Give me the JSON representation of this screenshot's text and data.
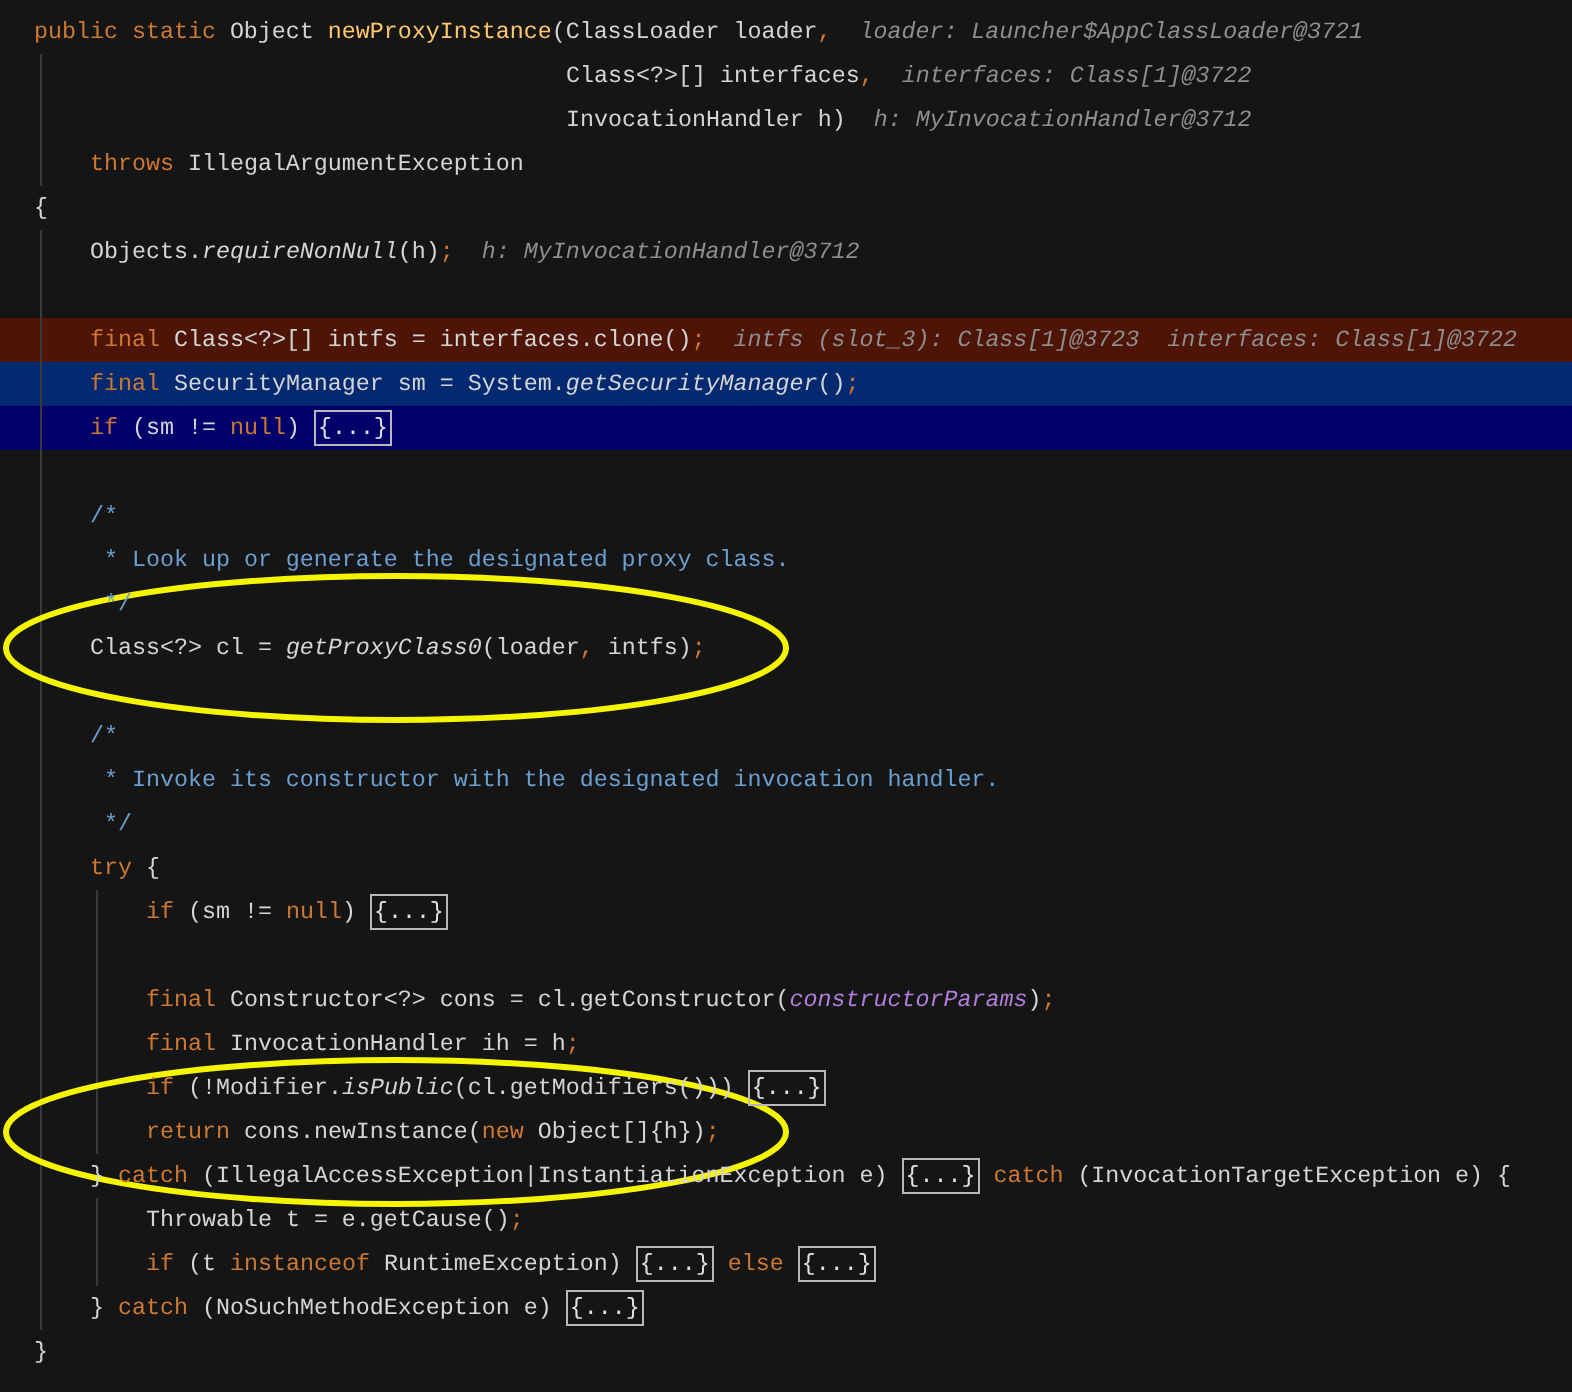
{
  "lines": [
    {
      "kind": "plain",
      "circled": false,
      "tokens": [
        {
          "kind": "kw",
          "text": "public static "
        },
        {
          "kind": "plain",
          "text": "Object "
        },
        {
          "kind": "method",
          "text": "newProxyInstance"
        },
        {
          "kind": "plain",
          "text": "(ClassLoader loader"
        },
        {
          "kind": "punct",
          "text": ","
        },
        {
          "kind": "hint",
          "text": "loader: Launcher$AppClassLoader@3721"
        }
      ]
    },
    {
      "kind": "plain",
      "circled": false,
      "tokens": [
        {
          "kind": "plain",
          "text": "                                      Class<?>[] interfaces"
        },
        {
          "kind": "punct",
          "text": ","
        },
        {
          "kind": "hint",
          "text": "interfaces: Class[1]@3722"
        }
      ]
    },
    {
      "kind": "plain",
      "circled": false,
      "tokens": [
        {
          "kind": "plain",
          "text": "                                      InvocationHandler h)"
        },
        {
          "kind": "hint",
          "text": "h: MyInvocationHandler@3712"
        }
      ]
    },
    {
      "kind": "plain",
      "circled": false,
      "tokens": [
        {
          "kind": "kw",
          "text": "    throws "
        },
        {
          "kind": "plain",
          "text": "IllegalArgumentException"
        }
      ]
    },
    {
      "kind": "plain",
      "circled": false,
      "tokens": [
        {
          "kind": "plain",
          "text": "{"
        }
      ]
    },
    {
      "kind": "plain",
      "circled": false,
      "tokens": [
        {
          "kind": "plain",
          "text": "    Objects."
        },
        {
          "kind": "static",
          "text": "requireNonNull"
        },
        {
          "kind": "plain",
          "text": "(h)"
        },
        {
          "kind": "punct",
          "text": ";"
        },
        {
          "kind": "hint",
          "text": "h: MyInvocationHandler@3712"
        }
      ]
    },
    {
      "kind": "plain",
      "circled": false
    },
    {
      "kind": "breakpoint",
      "circled": false,
      "tokens": [
        {
          "kind": "kw",
          "text": "    final "
        },
        {
          "kind": "plain",
          "text": "Class<?>[] intfs = interfaces.clone()"
        },
        {
          "kind": "punct",
          "text": ";"
        },
        {
          "kind": "hint",
          "text": "intfs (slot_3): Class[1]@3723"
        },
        {
          "kind": "hint",
          "text": "interfaces: Class[1]@3722"
        }
      ]
    },
    {
      "kind": "execution",
      "circled": false,
      "tokens": [
        {
          "kind": "kw",
          "text": "    final "
        },
        {
          "kind": "plain",
          "text": "SecurityManager sm = System."
        },
        {
          "kind": "static",
          "text": "getSecurityManager"
        },
        {
          "kind": "plain",
          "text": "()"
        },
        {
          "kind": "punct",
          "text": ";"
        }
      ]
    },
    {
      "kind": "selection",
      "circled": false,
      "tokens": [
        {
          "kind": "kw",
          "text": "    if "
        },
        {
          "kind": "plain",
          "text": "(sm != "
        },
        {
          "kind": "kw",
          "text": "null"
        },
        {
          "kind": "plain",
          "text": ") "
        },
        {
          "kind": "fold",
          "text": "{...}"
        }
      ]
    },
    {
      "kind": "plain",
      "circled": false
    },
    {
      "kind": "plain",
      "circled": false,
      "tokens": [
        {
          "kind": "comment",
          "text": "    /*"
        }
      ]
    },
    {
      "kind": "plain",
      "circled": false,
      "tokens": [
        {
          "kind": "comment",
          "text": "     * Look up or generate the designated proxy class."
        }
      ]
    },
    {
      "kind": "plain",
      "circled": false,
      "tokens": [
        {
          "kind": "comment",
          "text": "     */"
        }
      ]
    },
    {
      "kind": "plain",
      "circled": true,
      "tokens": [
        {
          "kind": "plain",
          "text": "    Class<?> cl = "
        },
        {
          "kind": "static",
          "text": "getProxyClass0"
        },
        {
          "kind": "plain",
          "text": "(loader"
        },
        {
          "kind": "punct",
          "text": ","
        },
        {
          "kind": "plain",
          "text": " intfs)"
        },
        {
          "kind": "punct",
          "text": ";"
        }
      ]
    },
    {
      "kind": "plain",
      "circled": false
    },
    {
      "kind": "plain",
      "circled": false,
      "tokens": [
        {
          "kind": "comment",
          "text": "    /*"
        }
      ]
    },
    {
      "kind": "plain",
      "circled": false,
      "tokens": [
        {
          "kind": "comment",
          "text": "     * Invoke its constructor with the designated invocation handler."
        }
      ]
    },
    {
      "kind": "plain",
      "circled": false,
      "tokens": [
        {
          "kind": "comment",
          "text": "     */"
        }
      ]
    },
    {
      "kind": "plain",
      "circled": false,
      "tokens": [
        {
          "kind": "kw",
          "text": "    try "
        },
        {
          "kind": "plain",
          "text": "{"
        }
      ]
    },
    {
      "kind": "plain",
      "circled": false,
      "tokens": [
        {
          "kind": "kw",
          "text": "        if "
        },
        {
          "kind": "plain",
          "text": "(sm != "
        },
        {
          "kind": "kw",
          "text": "null"
        },
        {
          "kind": "plain",
          "text": ") "
        },
        {
          "kind": "fold",
          "text": "{...}"
        }
      ]
    },
    {
      "kind": "plain",
      "circled": false
    },
    {
      "kind": "plain",
      "circled": false,
      "tokens": [
        {
          "kind": "kw",
          "text": "        final "
        },
        {
          "kind": "plain",
          "text": "Constructor<?> cons = cl.getConstructor("
        },
        {
          "kind": "field",
          "text": "constructorParams"
        },
        {
          "kind": "plain",
          "text": ")"
        },
        {
          "kind": "punct",
          "text": ";"
        }
      ]
    },
    {
      "kind": "plain",
      "circled": false,
      "tokens": [
        {
          "kind": "kw",
          "text": "        final "
        },
        {
          "kind": "plain",
          "text": "InvocationHandler ih = h"
        },
        {
          "kind": "punct",
          "text": ";"
        }
      ]
    },
    {
      "kind": "plain",
      "circled": false,
      "tokens": [
        {
          "kind": "kw",
          "text": "        if "
        },
        {
          "kind": "plain",
          "text": "(!Modifier."
        },
        {
          "kind": "static",
          "text": "isPublic"
        },
        {
          "kind": "plain",
          "text": "(cl.getModifiers())) "
        },
        {
          "kind": "fold",
          "text": "{...}"
        }
      ]
    },
    {
      "kind": "plain",
      "circled": true,
      "tokens": [
        {
          "kind": "kw",
          "text": "        return "
        },
        {
          "kind": "plain",
          "text": "cons.newInstance("
        },
        {
          "kind": "kw",
          "text": "new "
        },
        {
          "kind": "plain",
          "text": "Object[]{h})"
        },
        {
          "kind": "punct",
          "text": ";"
        }
      ]
    },
    {
      "kind": "plain",
      "circled": false,
      "tokens": [
        {
          "kind": "plain",
          "text": "    } "
        },
        {
          "kind": "kw",
          "text": "catch "
        },
        {
          "kind": "plain",
          "text": "(IllegalAccessException|InstantiationException e) "
        },
        {
          "kind": "fold",
          "text": "{...}"
        },
        {
          "kind": "kw",
          "text": " catch "
        },
        {
          "kind": "plain",
          "text": "(InvocationTargetException e) {"
        }
      ]
    },
    {
      "kind": "plain",
      "circled": false,
      "tokens": [
        {
          "kind": "plain",
          "text": "        Throwable t = e.getCause()"
        },
        {
          "kind": "punct",
          "text": ";"
        }
      ]
    },
    {
      "kind": "plain",
      "circled": false,
      "tokens": [
        {
          "kind": "kw",
          "text": "        if "
        },
        {
          "kind": "plain",
          "text": "(t "
        },
        {
          "kind": "kw",
          "text": "instanceof "
        },
        {
          "kind": "plain",
          "text": "RuntimeException) "
        },
        {
          "kind": "fold",
          "text": "{...}"
        },
        {
          "kind": "kw",
          "text": " else "
        },
        {
          "kind": "fold",
          "text": "{...}"
        }
      ]
    },
    {
      "kind": "plain",
      "circled": false,
      "tokens": [
        {
          "kind": "plain",
          "text": "    } "
        },
        {
          "kind": "kw",
          "text": "catch "
        },
        {
          "kind": "plain",
          "text": "(NoSuchMethodException e) "
        },
        {
          "kind": "fold",
          "text": "{...}"
        }
      ]
    },
    {
      "kind": "plain",
      "circled": false,
      "tokens": [
        {
          "kind": "plain",
          "text": "}"
        }
      ]
    }
  ]
}
